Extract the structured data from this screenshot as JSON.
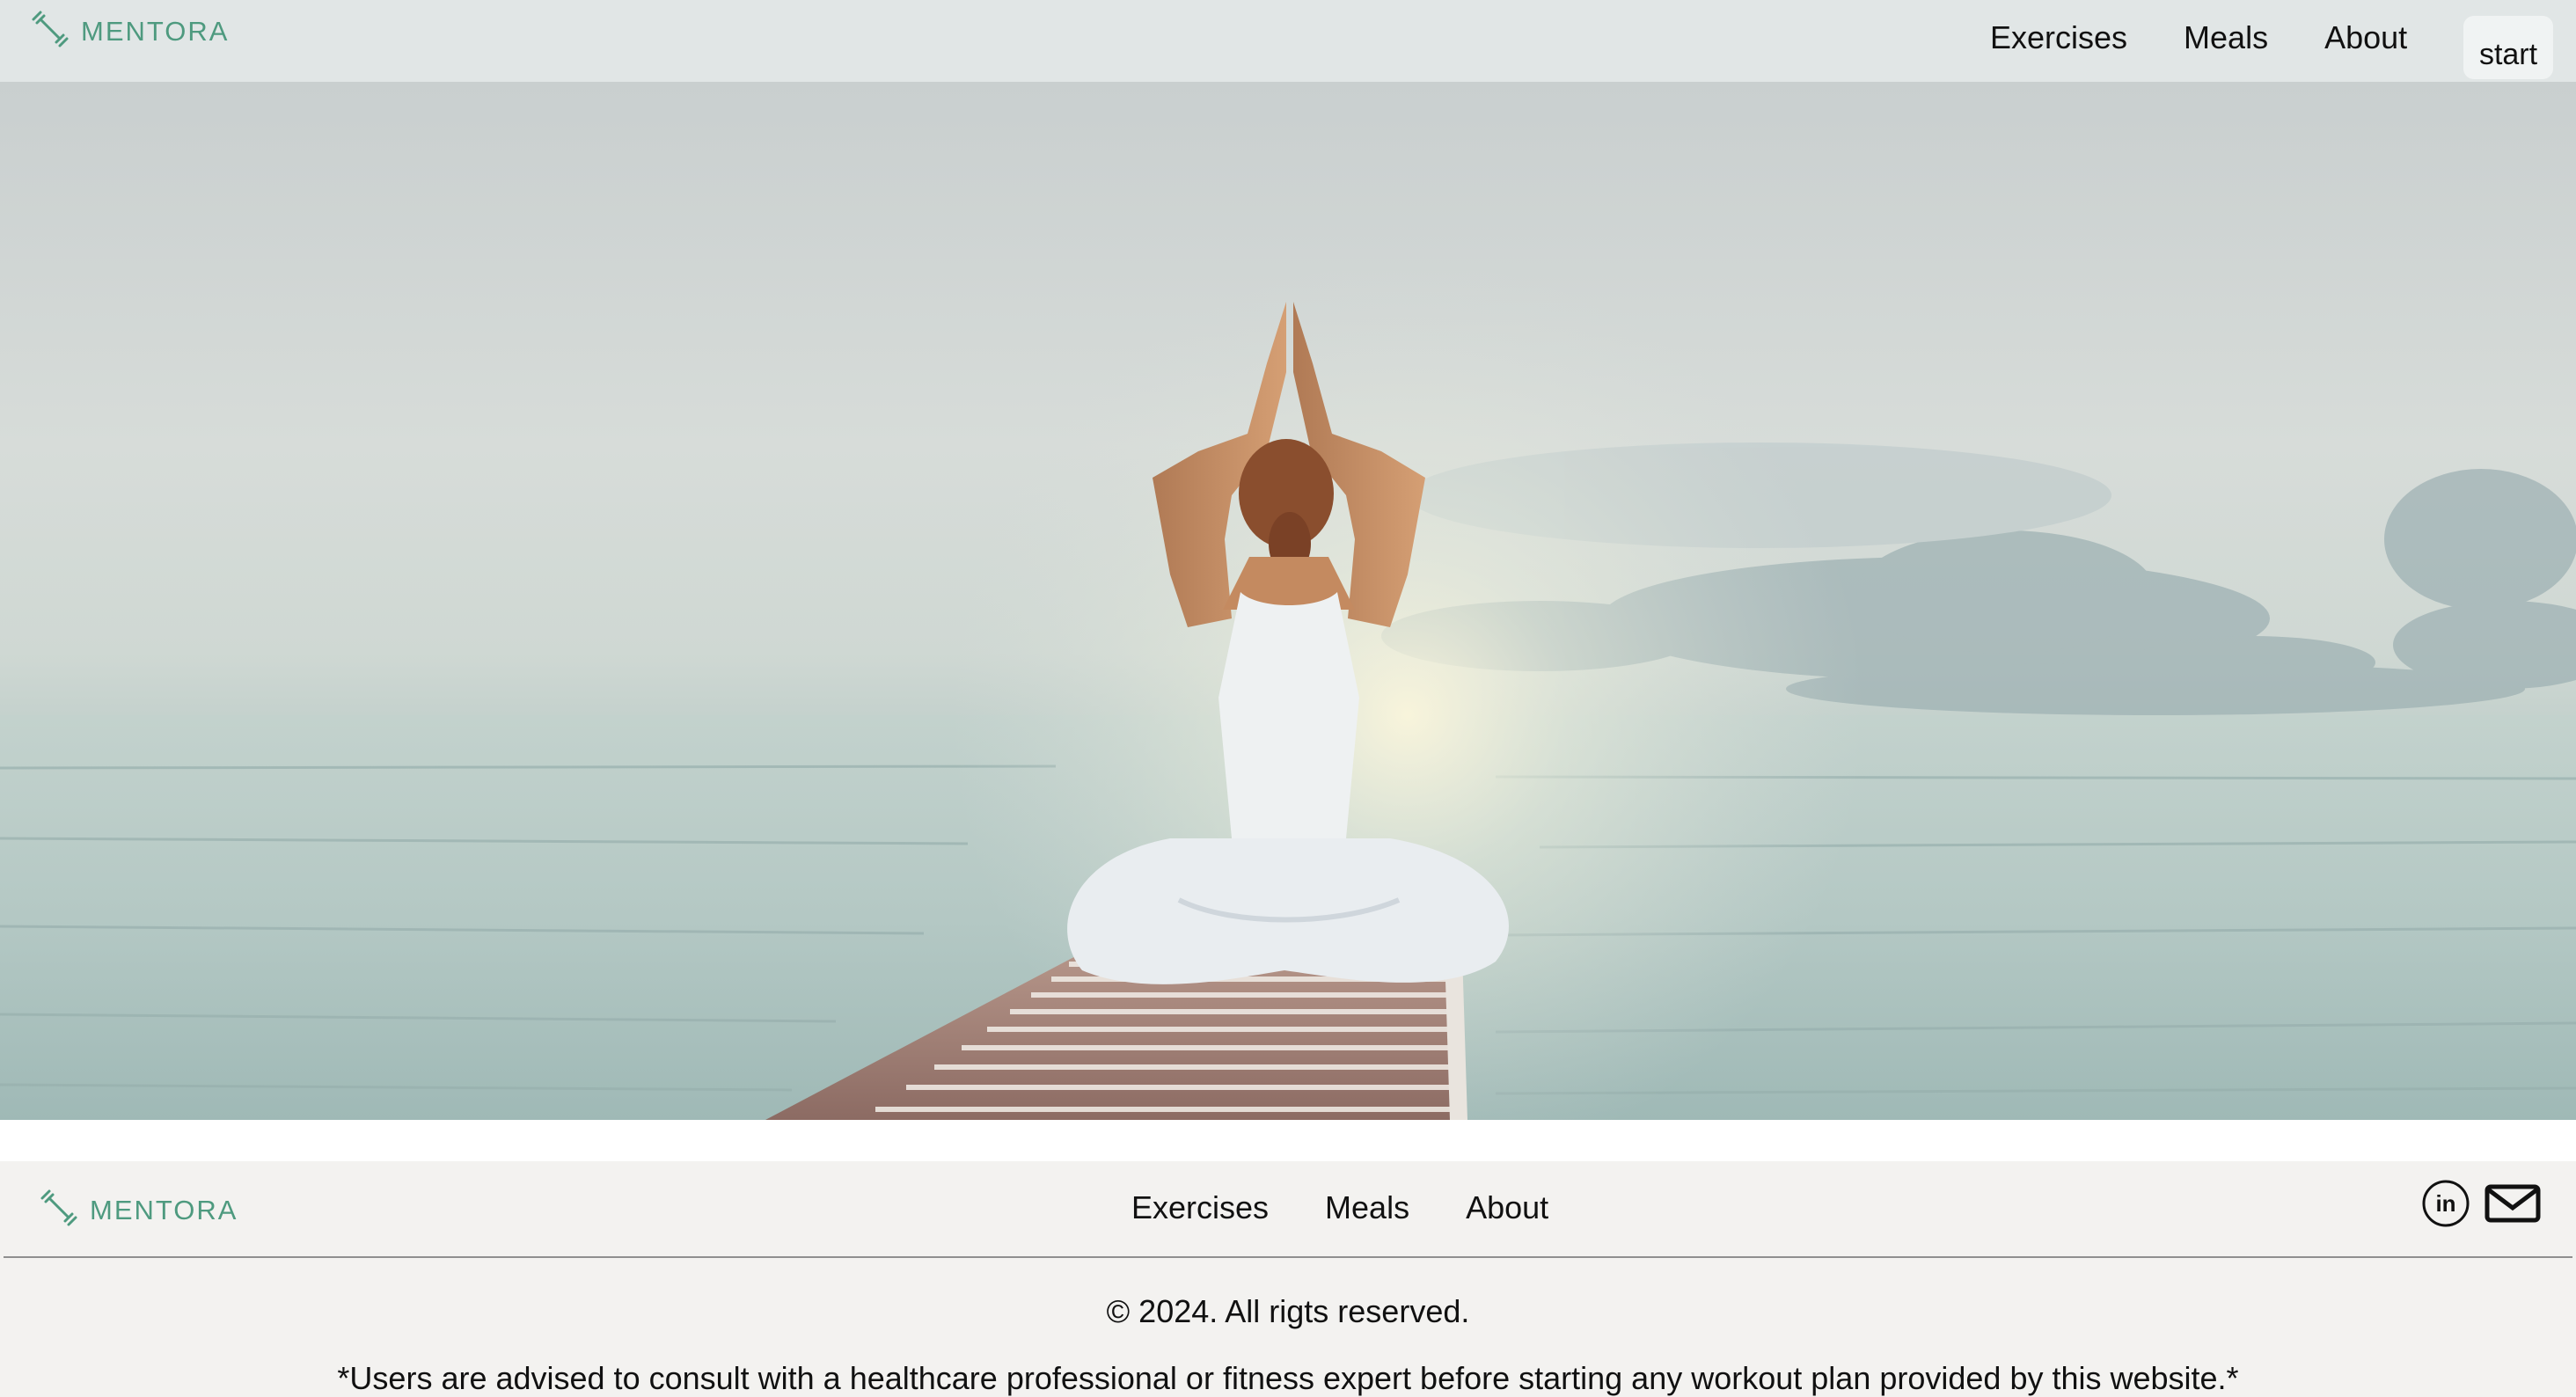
{
  "header": {
    "logo_text": "MENTORA",
    "logo_icon": "dumbbell-icon",
    "nav": [
      "Exercises",
      "Meals",
      "About"
    ],
    "start_label": "start"
  },
  "hero": {
    "image": "woman-meditating-on-pier-over-sea"
  },
  "footer": {
    "logo_text": "MENTORA",
    "logo_icon": "dumbbell-icon",
    "nav": [
      "Exercises",
      "Meals",
      "About"
    ],
    "social_icons": [
      "linkedin-icon",
      "mail-icon"
    ],
    "copyright": "© 2024. All rigts reserved.",
    "disclaimer": "*Users are advised to consult with a healthcare professional or fitness expert before starting any workout plan provided by this website.*"
  },
  "colors": {
    "brand": "#4e9a7f",
    "footer_bg": "#f3f2f0",
    "nav_bg": "#e0e5e5"
  }
}
